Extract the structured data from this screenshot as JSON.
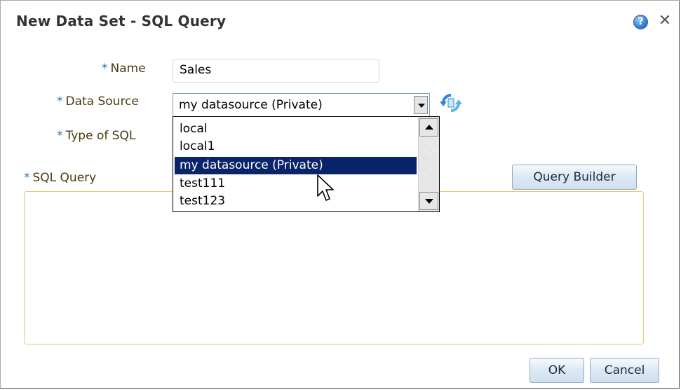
{
  "dialog": {
    "title": "New Data Set - SQL Query",
    "help_icon": "question-circle-icon",
    "close_glyph": "✕"
  },
  "form": {
    "required_marker": "*",
    "name_label": "Name",
    "name_value": "Sales",
    "data_source_label": "Data Source",
    "data_source_value": "my datasource (Private)",
    "type_of_sql_label": "Type of SQL",
    "sql_query_label": "SQL Query",
    "sql_query_value": ""
  },
  "dropdown": {
    "options": [
      "local",
      "local1",
      "my datasource (Private)",
      "test111",
      "test123"
    ],
    "highlighted": "my datasource (Private)"
  },
  "buttons": {
    "query_builder": "Query Builder",
    "ok": "OK",
    "cancel": "Cancel"
  },
  "colors": {
    "label_text": "#4a3a12",
    "required_marker": "#2f6cab",
    "selection_bg": "#0a246a",
    "sql_area_border": "#e8c97a",
    "button_gradient_bottom": "#cfdff1"
  }
}
